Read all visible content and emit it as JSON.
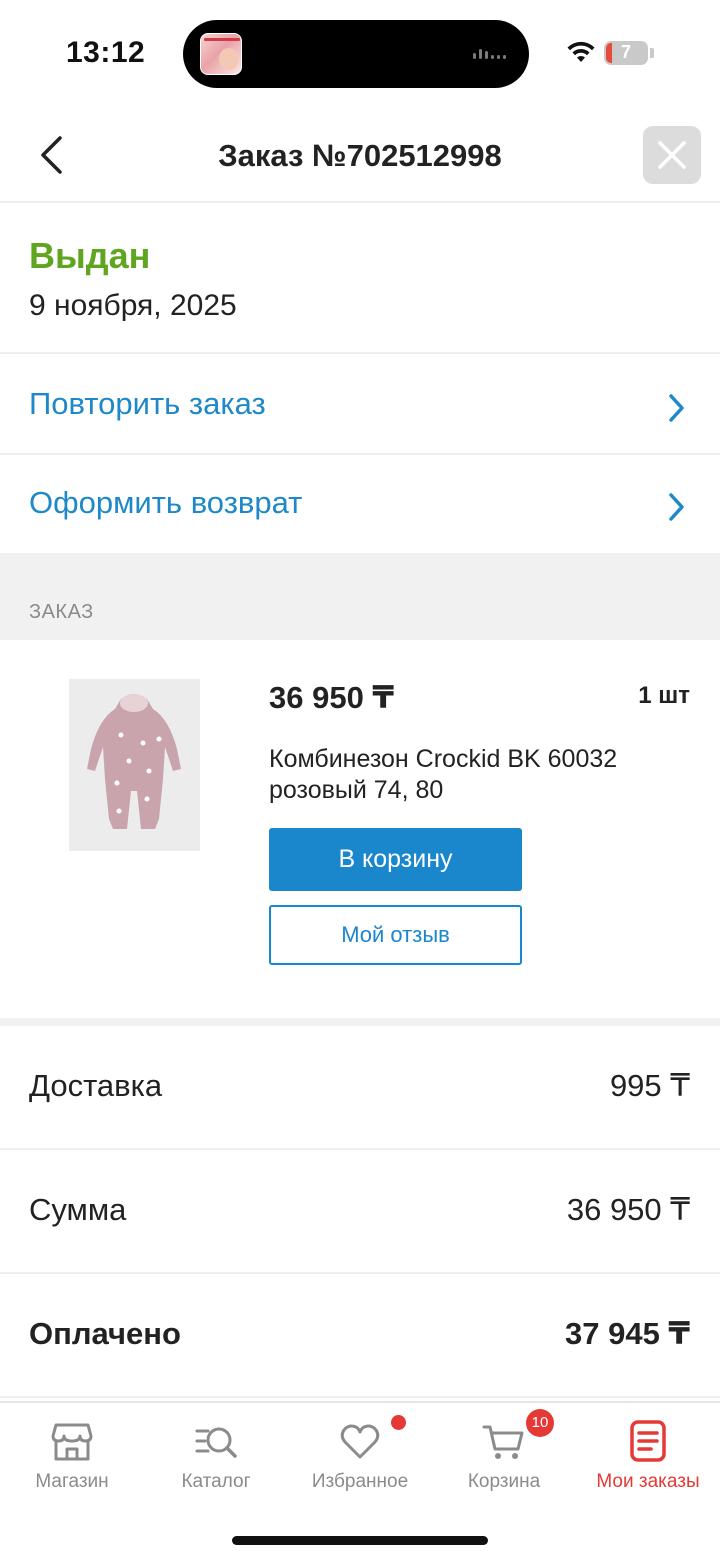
{
  "status_bar": {
    "time": "13:12",
    "battery": "7"
  },
  "header": {
    "title": "Заказ №702512998"
  },
  "order": {
    "status": "Выдан",
    "date": "9 ноября, 2025",
    "status_color": "#5fa520"
  },
  "actions": {
    "repeat": "Повторить заказ",
    "return": "Оформить возврат"
  },
  "section": {
    "title": "ЗАКАЗ"
  },
  "item": {
    "price": "36 950 ₸",
    "qty": "1 шт",
    "name": "Комбинезон Crockid BK 60032 розовый 74, 80",
    "cart_button": "В корзину",
    "review_button": "Мой отзыв"
  },
  "totals": [
    {
      "label": "Доставка",
      "value": "995 ₸"
    },
    {
      "label": "Сумма",
      "value": "36 950 ₸"
    },
    {
      "label": "Оплачено",
      "value": "37 945 ₸"
    }
  ],
  "tabs": [
    {
      "label": "Магазин",
      "icon": "store-icon"
    },
    {
      "label": "Каталог",
      "icon": "catalog-search-icon"
    },
    {
      "label": "Избранное",
      "icon": "heart-icon"
    },
    {
      "label": "Корзина",
      "icon": "cart-icon",
      "badge": "10"
    },
    {
      "label": "Мои заказы",
      "icon": "orders-icon",
      "active": true
    }
  ],
  "colors": {
    "accent": "#1a86cc",
    "active_tab": "#e53935",
    "badge": "#e53935"
  }
}
